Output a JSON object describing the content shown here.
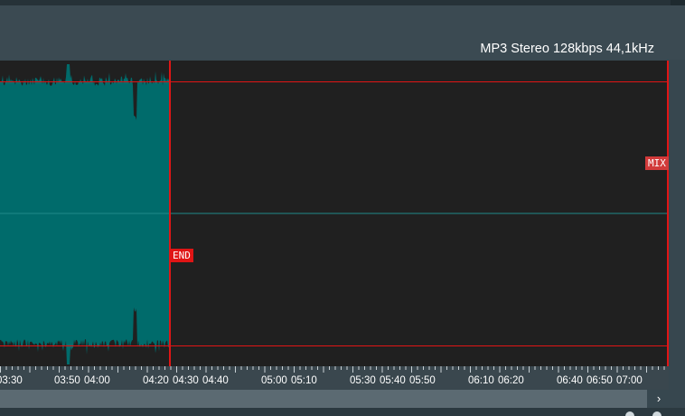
{
  "header": {
    "format_info": "MP3 Stereo 128kbps 44,1kHz"
  },
  "markers": {
    "end_label": "END",
    "mix_label": "MIX"
  },
  "timeline": {
    "labels": [
      "03:30",
      "03:50",
      "04:00",
      "04:20",
      "04:30",
      "04:40",
      "05:00",
      "05:10",
      "05:30",
      "05:40",
      "05:50",
      "06:10",
      "06:20",
      "06:40",
      "06:50",
      "07:00"
    ]
  },
  "scrollbar": {
    "right_arrow": "›"
  },
  "colors": {
    "waveform": "#006b6b",
    "marker": "#e01515",
    "background": "#202020"
  }
}
